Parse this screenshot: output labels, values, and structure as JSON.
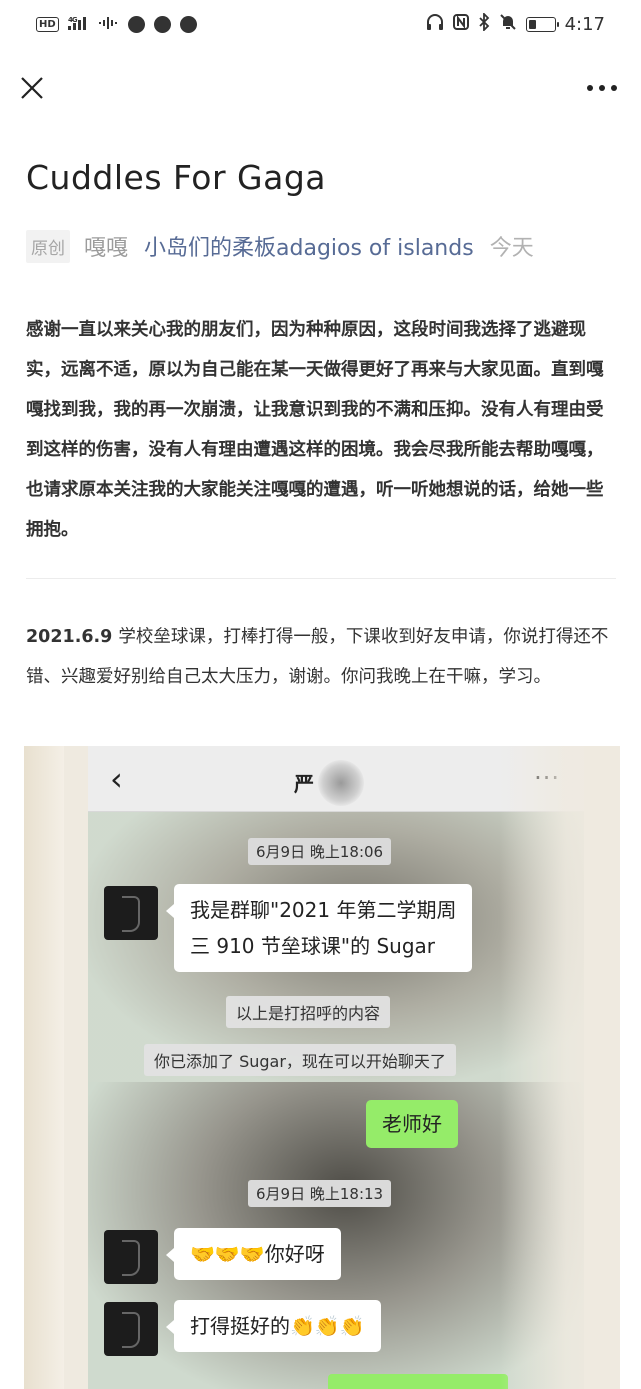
{
  "status_bar": {
    "left": [
      "HD",
      "4G",
      "▂▄▆",
      "≈",
      "",
      "",
      ""
    ],
    "right_icons": [
      "headphones-icon",
      "nfc-icon",
      "bluetooth-icon",
      "mute-icon"
    ],
    "battery_level": 0.3,
    "time": "4:17"
  },
  "nav": {
    "close_icon": "close-icon",
    "more_icon": "more-icon"
  },
  "article": {
    "title": "Cuddles For Gaga",
    "badge": "原创",
    "author": "嘎嘎",
    "account": "小岛们的柔板adagios of islands",
    "date": "今天",
    "intro": "感谢一直以来关心我的朋友们，因为种种原因，这段时间我选择了逃避现实，远离不适，原以为自己能在某一天做得更好了再来与大家见面。直到嘎嘎找到我，我的再一次崩溃，让我意识到我的不满和压抑。没有人有理由受到这样的伤害，没有人有理由遭遇这样的困境。我会尽我所能去帮助嘎嘎，也请求原本关注我的大家能关注嘎嘎的遭遇，听一听她想说的话，给她一些拥抱。",
    "entry_date": "2021.6.9",
    "entry_text": "学校垒球课，打棒打得一般，下课收到好友申请，你说打得还不错、兴趣爱好别给自己太大压力，谢谢。你问我晚上在干嘛，学习。"
  },
  "chat": {
    "back": "‹",
    "name": "严",
    "more": "···",
    "ts1": "6月9日 晚上18:06",
    "msg1": [
      "我是群聊\"2021 年第二学期周",
      "三 910 节垒球课\"的 Sugar"
    ],
    "sys1": "以上是打招呼的内容",
    "sys2": "你已添加了 Sugar，现在可以开始聊天了",
    "me1": "老师好",
    "ts2": "6月9日 晚上18:13",
    "msg2_emoji": "🤝🤝🤝",
    "msg2_text": "你好呀",
    "msg3_text": "打得挺好的",
    "msg3_emoji": "👏👏👏",
    "colors": {
      "green": "#95ec69",
      "link": "#576b95"
    }
  }
}
